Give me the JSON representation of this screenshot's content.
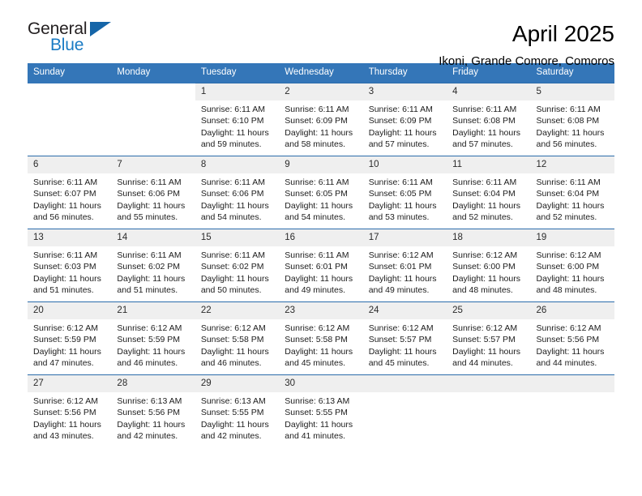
{
  "brand": {
    "line1": "General",
    "line2": "Blue",
    "triangle_color": "#1565a8"
  },
  "header": {
    "month_title": "April 2025",
    "location": "Ikoni, Grande Comore, Comoros"
  },
  "theme": {
    "header_blue": "#3476b8",
    "row_divider_blue": "#2b6cab",
    "daynum_bg": "#efefef"
  },
  "calendar": {
    "day_names": [
      "Sunday",
      "Monday",
      "Tuesday",
      "Wednesday",
      "Thursday",
      "Friday",
      "Saturday"
    ],
    "weeks": [
      [
        {
          "blank": true
        },
        {
          "blank": true
        },
        {
          "day": "1",
          "sunrise": "Sunrise: 6:11 AM",
          "sunset": "Sunset: 6:10 PM",
          "daylight": "Daylight: 11 hours and 59 minutes."
        },
        {
          "day": "2",
          "sunrise": "Sunrise: 6:11 AM",
          "sunset": "Sunset: 6:09 PM",
          "daylight": "Daylight: 11 hours and 58 minutes."
        },
        {
          "day": "3",
          "sunrise": "Sunrise: 6:11 AM",
          "sunset": "Sunset: 6:09 PM",
          "daylight": "Daylight: 11 hours and 57 minutes."
        },
        {
          "day": "4",
          "sunrise": "Sunrise: 6:11 AM",
          "sunset": "Sunset: 6:08 PM",
          "daylight": "Daylight: 11 hours and 57 minutes."
        },
        {
          "day": "5",
          "sunrise": "Sunrise: 6:11 AM",
          "sunset": "Sunset: 6:08 PM",
          "daylight": "Daylight: 11 hours and 56 minutes."
        }
      ],
      [
        {
          "day": "6",
          "sunrise": "Sunrise: 6:11 AM",
          "sunset": "Sunset: 6:07 PM",
          "daylight": "Daylight: 11 hours and 56 minutes."
        },
        {
          "day": "7",
          "sunrise": "Sunrise: 6:11 AM",
          "sunset": "Sunset: 6:06 PM",
          "daylight": "Daylight: 11 hours and 55 minutes."
        },
        {
          "day": "8",
          "sunrise": "Sunrise: 6:11 AM",
          "sunset": "Sunset: 6:06 PM",
          "daylight": "Daylight: 11 hours and 54 minutes."
        },
        {
          "day": "9",
          "sunrise": "Sunrise: 6:11 AM",
          "sunset": "Sunset: 6:05 PM",
          "daylight": "Daylight: 11 hours and 54 minutes."
        },
        {
          "day": "10",
          "sunrise": "Sunrise: 6:11 AM",
          "sunset": "Sunset: 6:05 PM",
          "daylight": "Daylight: 11 hours and 53 minutes."
        },
        {
          "day": "11",
          "sunrise": "Sunrise: 6:11 AM",
          "sunset": "Sunset: 6:04 PM",
          "daylight": "Daylight: 11 hours and 52 minutes."
        },
        {
          "day": "12",
          "sunrise": "Sunrise: 6:11 AM",
          "sunset": "Sunset: 6:04 PM",
          "daylight": "Daylight: 11 hours and 52 minutes."
        }
      ],
      [
        {
          "day": "13",
          "sunrise": "Sunrise: 6:11 AM",
          "sunset": "Sunset: 6:03 PM",
          "daylight": "Daylight: 11 hours and 51 minutes."
        },
        {
          "day": "14",
          "sunrise": "Sunrise: 6:11 AM",
          "sunset": "Sunset: 6:02 PM",
          "daylight": "Daylight: 11 hours and 51 minutes."
        },
        {
          "day": "15",
          "sunrise": "Sunrise: 6:11 AM",
          "sunset": "Sunset: 6:02 PM",
          "daylight": "Daylight: 11 hours and 50 minutes."
        },
        {
          "day": "16",
          "sunrise": "Sunrise: 6:11 AM",
          "sunset": "Sunset: 6:01 PM",
          "daylight": "Daylight: 11 hours and 49 minutes."
        },
        {
          "day": "17",
          "sunrise": "Sunrise: 6:12 AM",
          "sunset": "Sunset: 6:01 PM",
          "daylight": "Daylight: 11 hours and 49 minutes."
        },
        {
          "day": "18",
          "sunrise": "Sunrise: 6:12 AM",
          "sunset": "Sunset: 6:00 PM",
          "daylight": "Daylight: 11 hours and 48 minutes."
        },
        {
          "day": "19",
          "sunrise": "Sunrise: 6:12 AM",
          "sunset": "Sunset: 6:00 PM",
          "daylight": "Daylight: 11 hours and 48 minutes."
        }
      ],
      [
        {
          "day": "20",
          "sunrise": "Sunrise: 6:12 AM",
          "sunset": "Sunset: 5:59 PM",
          "daylight": "Daylight: 11 hours and 47 minutes."
        },
        {
          "day": "21",
          "sunrise": "Sunrise: 6:12 AM",
          "sunset": "Sunset: 5:59 PM",
          "daylight": "Daylight: 11 hours and 46 minutes."
        },
        {
          "day": "22",
          "sunrise": "Sunrise: 6:12 AM",
          "sunset": "Sunset: 5:58 PM",
          "daylight": "Daylight: 11 hours and 46 minutes."
        },
        {
          "day": "23",
          "sunrise": "Sunrise: 6:12 AM",
          "sunset": "Sunset: 5:58 PM",
          "daylight": "Daylight: 11 hours and 45 minutes."
        },
        {
          "day": "24",
          "sunrise": "Sunrise: 6:12 AM",
          "sunset": "Sunset: 5:57 PM",
          "daylight": "Daylight: 11 hours and 45 minutes."
        },
        {
          "day": "25",
          "sunrise": "Sunrise: 6:12 AM",
          "sunset": "Sunset: 5:57 PM",
          "daylight": "Daylight: 11 hours and 44 minutes."
        },
        {
          "day": "26",
          "sunrise": "Sunrise: 6:12 AM",
          "sunset": "Sunset: 5:56 PM",
          "daylight": "Daylight: 11 hours and 44 minutes."
        }
      ],
      [
        {
          "day": "27",
          "sunrise": "Sunrise: 6:12 AM",
          "sunset": "Sunset: 5:56 PM",
          "daylight": "Daylight: 11 hours and 43 minutes."
        },
        {
          "day": "28",
          "sunrise": "Sunrise: 6:13 AM",
          "sunset": "Sunset: 5:56 PM",
          "daylight": "Daylight: 11 hours and 42 minutes."
        },
        {
          "day": "29",
          "sunrise": "Sunrise: 6:13 AM",
          "sunset": "Sunset: 5:55 PM",
          "daylight": "Daylight: 11 hours and 42 minutes."
        },
        {
          "day": "30",
          "sunrise": "Sunrise: 6:13 AM",
          "sunset": "Sunset: 5:55 PM",
          "daylight": "Daylight: 11 hours and 41 minutes."
        },
        {
          "empty": true
        },
        {
          "empty": true
        },
        {
          "empty": true
        }
      ]
    ]
  }
}
